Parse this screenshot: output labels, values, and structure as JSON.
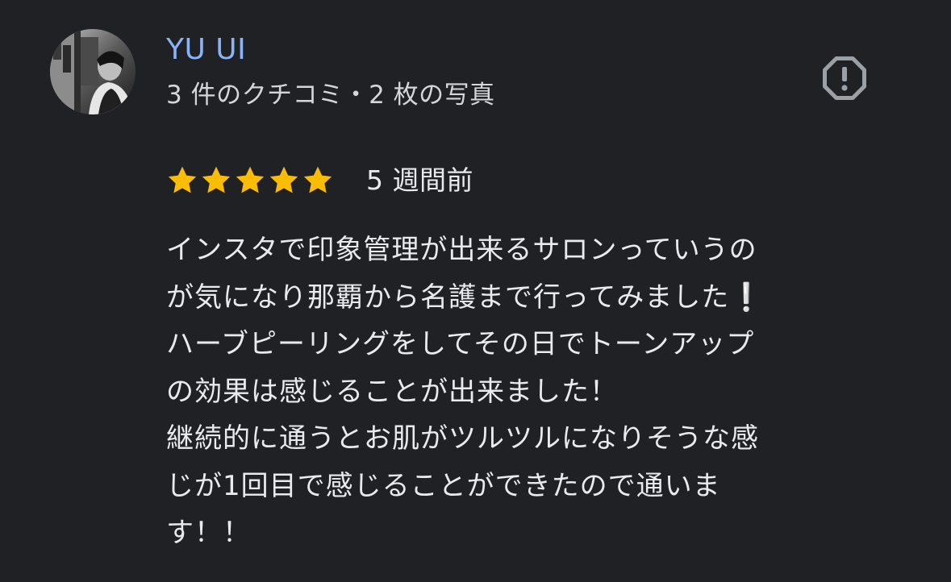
{
  "reviewer": {
    "name": "YU UI",
    "meta": "3 件のクチコミ・2 枚の写真"
  },
  "report": {
    "icon": "report-flag-icon"
  },
  "rating": {
    "stars": 5,
    "max_stars": 5,
    "star_color": "#fbbc04",
    "date": "5 週間前"
  },
  "review": {
    "lines": [
      "インスタで印象管理が出来るサロンっていうの",
      "が気になり那覇から名護まで行ってみました❕",
      "ハーブピーリングをしてその日でトーンアップ",
      "の効果は感じることが出来ました！",
      "継続的に通うとお肌がツルツルになりそうな感",
      "じが1回目で感じることができたので通いま",
      "す！！"
    ]
  },
  "colors": {
    "background": "#202124",
    "name": "#8ab4f8",
    "text": "#e8eaed",
    "meta": "#d4d6d9",
    "icon": "#9aa0a6"
  }
}
